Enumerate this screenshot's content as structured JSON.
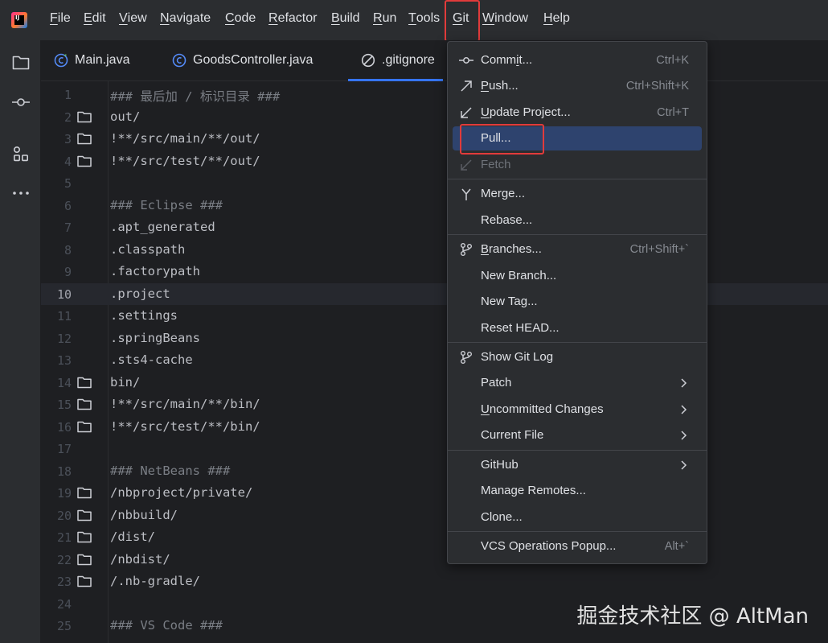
{
  "menubar": {
    "logo_text": "IJ",
    "items": [
      {
        "mnemonic": "F",
        "rest": "ile"
      },
      {
        "mnemonic": "E",
        "rest": "dit"
      },
      {
        "mnemonic": "V",
        "rest": "iew"
      },
      {
        "mnemonic": "N",
        "rest": "avigate"
      },
      {
        "mnemonic": "C",
        "rest": "ode"
      },
      {
        "mnemonic": "R",
        "rest": "efactor"
      },
      {
        "mnemonic": "B",
        "rest": "uild"
      },
      {
        "mnemonic": "R",
        "rest": "un"
      },
      {
        "mnemonic": "T",
        "rest": "ools"
      },
      {
        "mnemonic": "G",
        "rest": "it"
      },
      {
        "mnemonic": "W",
        "rest": "indow"
      },
      {
        "mnemonic": "H",
        "rest": "elp"
      }
    ]
  },
  "tabs": [
    {
      "label": "Main.java",
      "icon": "java-class-icon"
    },
    {
      "label": "GoodsController.java",
      "icon": "java-class-icon"
    },
    {
      "label": ".gitignore",
      "icon": "ignore-file-icon",
      "active": true
    }
  ],
  "editor": {
    "current_line": 10,
    "lines": [
      {
        "n": "1",
        "text": "### 最后加 / 标识目录 ###",
        "kind": "comment",
        "folder": false
      },
      {
        "n": "2",
        "text": "out/",
        "kind": "code",
        "folder": true
      },
      {
        "n": "3",
        "text": "!**/src/main/**/out/",
        "kind": "code",
        "folder": true
      },
      {
        "n": "4",
        "text": "!**/src/test/**/out/",
        "kind": "code",
        "folder": true
      },
      {
        "n": "5",
        "text": "",
        "kind": "code",
        "folder": false
      },
      {
        "n": "6",
        "text": "### Eclipse ###",
        "kind": "comment",
        "folder": false
      },
      {
        "n": "7",
        "text": ".apt_generated",
        "kind": "code",
        "folder": false
      },
      {
        "n": "8",
        "text": ".classpath",
        "kind": "code",
        "folder": false
      },
      {
        "n": "9",
        "text": ".factorypath",
        "kind": "code",
        "folder": false
      },
      {
        "n": "10",
        "text": ".project",
        "kind": "code",
        "folder": false
      },
      {
        "n": "11",
        "text": ".settings",
        "kind": "code",
        "folder": false
      },
      {
        "n": "12",
        "text": ".springBeans",
        "kind": "code",
        "folder": false
      },
      {
        "n": "13",
        "text": ".sts4-cache",
        "kind": "code",
        "folder": false
      },
      {
        "n": "14",
        "text": "bin/",
        "kind": "code",
        "folder": true
      },
      {
        "n": "15",
        "text": "!**/src/main/**/bin/",
        "kind": "code",
        "folder": true
      },
      {
        "n": "16",
        "text": "!**/src/test/**/bin/",
        "kind": "code",
        "folder": true
      },
      {
        "n": "17",
        "text": "",
        "kind": "code",
        "folder": false
      },
      {
        "n": "18",
        "text": "### NetBeans ###",
        "kind": "comment",
        "folder": false
      },
      {
        "n": "19",
        "text": "/nbproject/private/",
        "kind": "code",
        "folder": true
      },
      {
        "n": "20",
        "text": "/nbbuild/",
        "kind": "code",
        "folder": true
      },
      {
        "n": "21",
        "text": "/dist/",
        "kind": "code",
        "folder": true
      },
      {
        "n": "22",
        "text": "/nbdist/",
        "kind": "code",
        "folder": true
      },
      {
        "n": "23",
        "text": "/.nb-gradle/",
        "kind": "code",
        "folder": true
      },
      {
        "n": "24",
        "text": "",
        "kind": "code",
        "folder": false
      },
      {
        "n": "25",
        "text": "### VS Code ###",
        "kind": "comment",
        "folder": false
      }
    ]
  },
  "git_menu": {
    "items": [
      {
        "pre": "Comm",
        "mn": "i",
        "post": "t...",
        "shortcut": "Ctrl+K",
        "icon": "commit-icon",
        "name": "commit"
      },
      {
        "pre": "",
        "mn": "P",
        "post": "ush...",
        "shortcut": "Ctrl+Shift+K",
        "icon": "push-icon",
        "name": "push"
      },
      {
        "pre": "",
        "mn": "U",
        "post": "pdate Project...",
        "shortcut": "Ctrl+T",
        "icon": "update-project-icon",
        "name": "update-project"
      },
      {
        "pre": "Pull...",
        "mn": "",
        "post": "",
        "shortcut": "",
        "icon": "",
        "name": "pull",
        "selected": true
      },
      {
        "pre": "Fetch",
        "mn": "",
        "post": "",
        "shortcut": "",
        "icon": "fetch-icon",
        "name": "fetch",
        "disabled": true
      },
      {
        "sep": true
      },
      {
        "pre": "Merge...",
        "mn": "",
        "post": "",
        "shortcut": "",
        "icon": "merge-icon",
        "name": "merge"
      },
      {
        "pre": "Rebase...",
        "mn": "",
        "post": "",
        "shortcut": "",
        "icon": "",
        "name": "rebase"
      },
      {
        "sep": true
      },
      {
        "pre": "",
        "mn": "B",
        "post": "ranches...",
        "shortcut": "Ctrl+Shift+`",
        "icon": "branches-icon",
        "name": "branches"
      },
      {
        "pre": "New Branch...",
        "mn": "",
        "post": "",
        "shortcut": "",
        "icon": "",
        "name": "new-branch"
      },
      {
        "pre": "New Tag...",
        "mn": "",
        "post": "",
        "shortcut": "",
        "icon": "",
        "name": "new-tag"
      },
      {
        "pre": "Reset HEAD...",
        "mn": "",
        "post": "",
        "shortcut": "",
        "icon": "",
        "name": "reset-head"
      },
      {
        "sep": true
      },
      {
        "pre": "Show Git Log",
        "mn": "",
        "post": "",
        "shortcut": "",
        "icon": "git-log-icon",
        "name": "show-git-log"
      },
      {
        "pre": "Patch",
        "mn": "",
        "post": "",
        "shortcut": "",
        "icon": "",
        "name": "patch",
        "submenu": true
      },
      {
        "pre": "",
        "mn": "U",
        "post": "ncommitted Changes",
        "shortcut": "",
        "icon": "",
        "name": "uncommitted-changes",
        "submenu": true
      },
      {
        "pre": "Current File",
        "mn": "",
        "post": "",
        "shortcut": "",
        "icon": "",
        "name": "current-file",
        "submenu": true
      },
      {
        "sep": true
      },
      {
        "pre": "GitHub",
        "mn": "",
        "post": "",
        "shortcut": "",
        "icon": "",
        "name": "github",
        "submenu": true
      },
      {
        "pre": "Manage Remotes...",
        "mn": "",
        "post": "",
        "shortcut": "",
        "icon": "",
        "name": "manage-remotes"
      },
      {
        "pre": "Clone...",
        "mn": "",
        "post": "",
        "shortcut": "",
        "icon": "",
        "name": "clone"
      },
      {
        "sep": true
      },
      {
        "pre": "VCS Operations Popup...",
        "mn": "",
        "post": "",
        "shortcut": "Alt+`",
        "icon": "",
        "name": "vcs-operations-popup"
      }
    ]
  },
  "watermark": "掘金技术社区 @ AltMan",
  "colors": {
    "accent": "#3574f0",
    "highlight_box": "#e13b3b",
    "selection": "#2e436e"
  }
}
